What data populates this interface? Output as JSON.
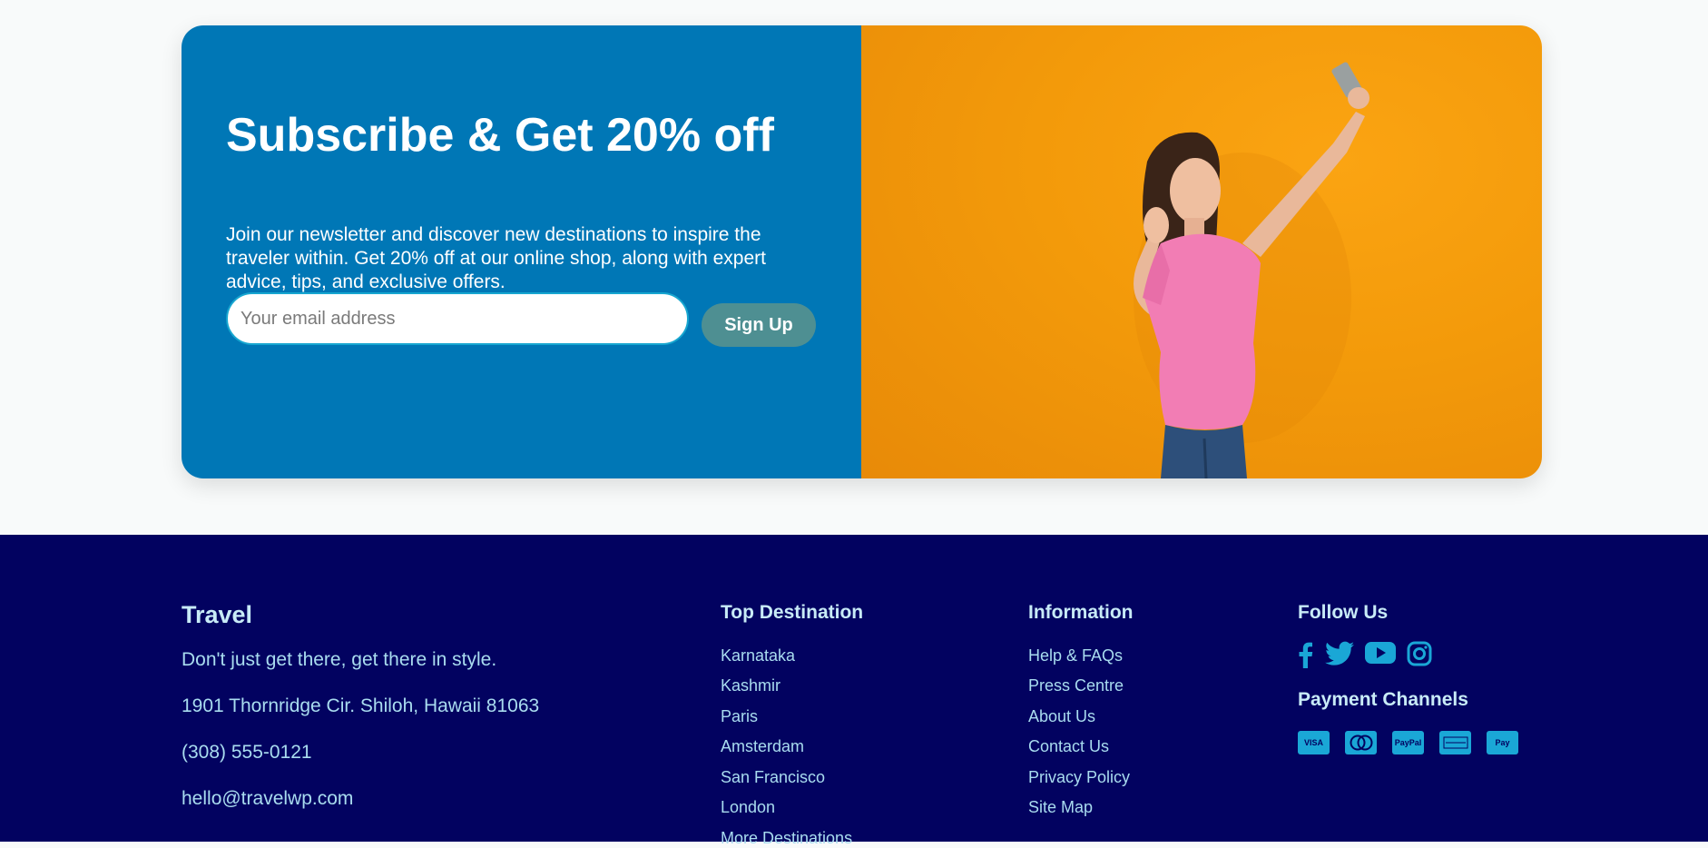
{
  "promo": {
    "title": "Subscribe & Get 20% off",
    "text": "Join our newsletter and discover new destinations to inspire the traveler within. Get 20% off at our online shop, along with expert advice, tips, and exclusive offers.",
    "email_placeholder": "Your email address",
    "signup_label": "Sign Up"
  },
  "footer": {
    "brand": "Travel",
    "tagline": "Don't just get there, get there in style.",
    "address": "1901 Thornridge Cir. Shiloh, Hawaii 81063",
    "phone": "(308) 555-0121",
    "email": "hello@travelwp.com",
    "destinations": {
      "title": "Top Destination",
      "items": [
        "Karnataka",
        "Kashmir",
        "Paris",
        "Amsterdam",
        "San Francisco",
        "London",
        "More Destinations"
      ]
    },
    "information": {
      "title": "Information",
      "items": [
        "Help & FAQs",
        "Press Centre",
        "About Us",
        "Contact Us",
        "Privacy Policy",
        "Site Map"
      ]
    },
    "follow": {
      "title": "Follow Us",
      "icons": [
        "facebook-icon",
        "twitter-icon",
        "youtube-icon",
        "instagram-icon"
      ]
    },
    "payment": {
      "title": "Payment Channels",
      "methods": [
        "VISA",
        "Mastercard",
        "PayPal",
        "American Express",
        "Apple Pay"
      ]
    }
  },
  "colors": {
    "promo_blue": "#0077b6",
    "promo_orange": "#f39a0a",
    "footer_navy": "#020260",
    "footer_text": "#a9dcef",
    "accent": "#1aa7d6",
    "signup_button": "#4e8f92"
  }
}
